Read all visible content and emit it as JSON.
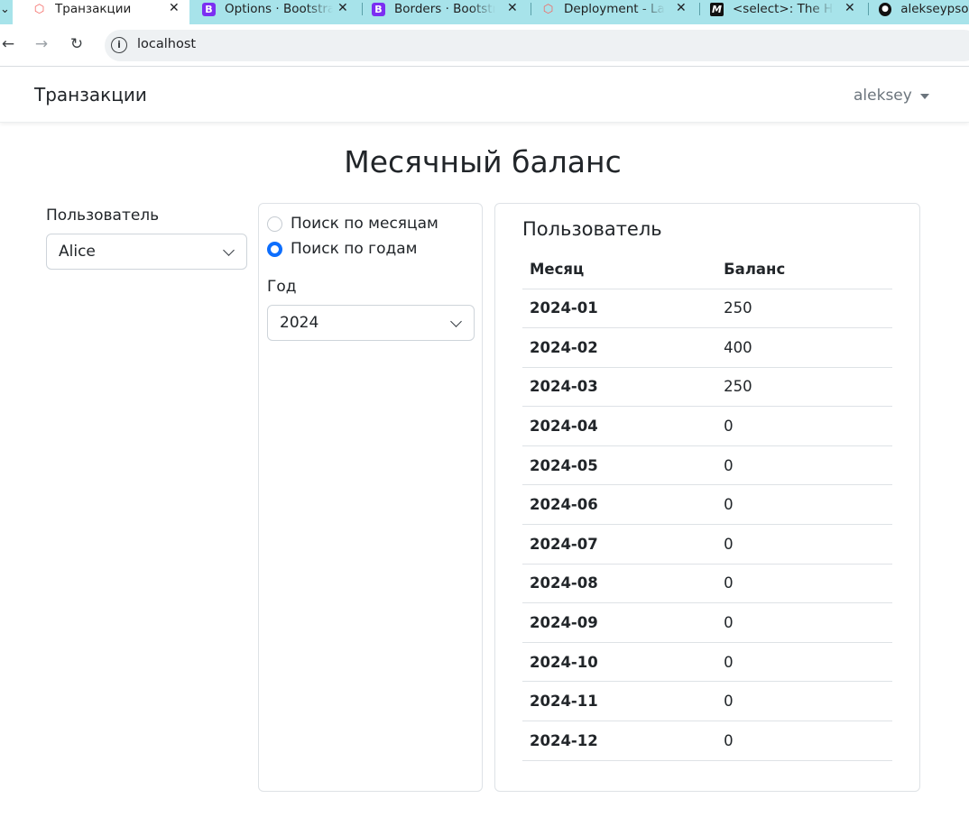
{
  "browser": {
    "tabs": [
      {
        "title": "Транзакции",
        "icon": "laravel-icon",
        "active": true
      },
      {
        "title": "Options · Bootstrap",
        "icon": "bootstrap-icon"
      },
      {
        "title": "Borders · Bootstrap",
        "icon": "bootstrap-icon"
      },
      {
        "title": "Deployment - Laravel",
        "icon": "laravel-icon"
      },
      {
        "title": "<select>: The HTML",
        "icon": "mdn-icon"
      },
      {
        "title": "alekseypsoft",
        "icon": "github-icon"
      }
    ],
    "url": "localhost"
  },
  "navbar": {
    "brand": "Транзакции",
    "user": "aleksey"
  },
  "page": {
    "title": "Месячный баланс"
  },
  "filters": {
    "user_label": "Пользователь",
    "user_selected": "Alice",
    "radio_months": "Поиск по месяцам",
    "radio_years": "Поиск по годам",
    "radio_selected": "years",
    "year_label": "Год",
    "year_selected": "2024"
  },
  "balance": {
    "card_title": "Пользователь",
    "columns": [
      "Месяц",
      "Баланс"
    ],
    "rows": [
      {
        "month": "2024-01",
        "balance": "250"
      },
      {
        "month": "2024-02",
        "balance": "400"
      },
      {
        "month": "2024-03",
        "balance": "250"
      },
      {
        "month": "2024-04",
        "balance": "0"
      },
      {
        "month": "2024-05",
        "balance": "0"
      },
      {
        "month": "2024-06",
        "balance": "0"
      },
      {
        "month": "2024-07",
        "balance": "0"
      },
      {
        "month": "2024-08",
        "balance": "0"
      },
      {
        "month": "2024-09",
        "balance": "0"
      },
      {
        "month": "2024-10",
        "balance": "0"
      },
      {
        "month": "2024-11",
        "balance": "0"
      },
      {
        "month": "2024-12",
        "balance": "0"
      }
    ]
  },
  "colors": {
    "tabbar": "#a7e3ea",
    "accent": "#0d6efd",
    "bootstrap_purple": "#7b2ff2",
    "laravel_red": "#f4645f"
  }
}
